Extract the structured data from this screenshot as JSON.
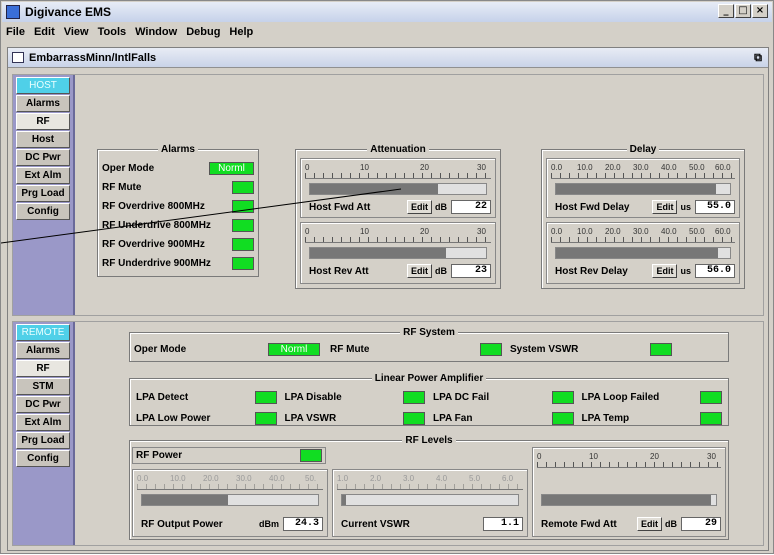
{
  "window": {
    "title": "Digivance EMS"
  },
  "menu": [
    "File",
    "Edit",
    "View",
    "Tools",
    "Window",
    "Debug",
    "Help"
  ],
  "inner": {
    "title": "EmbarrassMinn/IntlFalls"
  },
  "host": {
    "tabs": [
      "HOST",
      "Alarms",
      "RF",
      "Host",
      "DC Pwr",
      "Ext Alm",
      "Prg Load",
      "Config"
    ],
    "active_tab": "RF",
    "alarms": {
      "title": "Alarms",
      "items": [
        {
          "label": "Oper Mode",
          "value": "Norml",
          "type": "mode"
        },
        {
          "label": "RF Mute"
        },
        {
          "label": "RF Overdrive 800MHz"
        },
        {
          "label": "RF Underdrive 800MHz"
        },
        {
          "label": "RF Overdrive 900MHz"
        },
        {
          "label": "RF Underdrive 900MHz"
        }
      ]
    },
    "attenuation": {
      "title": "Attenuation",
      "scale": [
        "0",
        "10",
        "20",
        "30"
      ],
      "fwd": {
        "label": "Host Fwd Att",
        "edit": "Edit",
        "unit": "dB",
        "value": "22",
        "level": 0.73
      },
      "rev": {
        "label": "Host Rev Att",
        "edit": "Edit",
        "unit": "dB",
        "value": "23",
        "level": 0.77
      }
    },
    "delay": {
      "title": "Delay",
      "scale": [
        "0.0",
        "10.0",
        "20.0",
        "30.0",
        "40.0",
        "50.0",
        "60.0"
      ],
      "fwd": {
        "label": "Host Fwd Delay",
        "edit": "Edit",
        "unit": "us",
        "value": "55.0",
        "level": 0.92
      },
      "rev": {
        "label": "Host Rev Delay",
        "edit": "Edit",
        "unit": "us",
        "value": "56.0",
        "level": 0.93
      }
    }
  },
  "remote": {
    "tabs": [
      "REMOTE",
      "Alarms",
      "RF",
      "STM",
      "DC Pwr",
      "Ext Alm",
      "Prg Load",
      "Config"
    ],
    "active_tab": "RF",
    "rf_system": {
      "title": "RF System",
      "oper_mode": "Oper Mode",
      "oper_value": "Norml",
      "rf_mute": "RF Mute",
      "vswr": "System VSWR"
    },
    "lpa": {
      "title": "Linear Power Amplifier",
      "items": [
        "LPA Detect",
        "LPA Disable",
        "LPA DC Fail",
        "LPA Loop Failed",
        "LPA Low Power",
        "LPA VSWR",
        "LPA Fan",
        "LPA Temp"
      ]
    },
    "rf_levels": {
      "title": "RF Levels",
      "rf_power": "RF Power",
      "output": {
        "scale": [
          "0.0",
          "10.0",
          "20.0",
          "30.0",
          "40.0",
          "50."
        ],
        "label": "RF Output Power",
        "unit": "dBm",
        "value": "24.3",
        "level": 0.49
      },
      "vswr": {
        "scale": [
          "1.0",
          "2.0",
          "3.0",
          "4.0",
          "5.0",
          "6.0"
        ],
        "label": "Current VSWR",
        "value": "1.1",
        "level": 0.02
      },
      "fwd": {
        "scale": [
          "0",
          "10",
          "20",
          "30"
        ],
        "label": "Remote Fwd Att",
        "edit": "Edit",
        "unit": "dB",
        "value": "29",
        "level": 0.97
      }
    }
  },
  "colors": {
    "indicator_green": "#11dd22",
    "tab_bar": "#9a98c8",
    "head_tab": "#4fd0e8"
  }
}
